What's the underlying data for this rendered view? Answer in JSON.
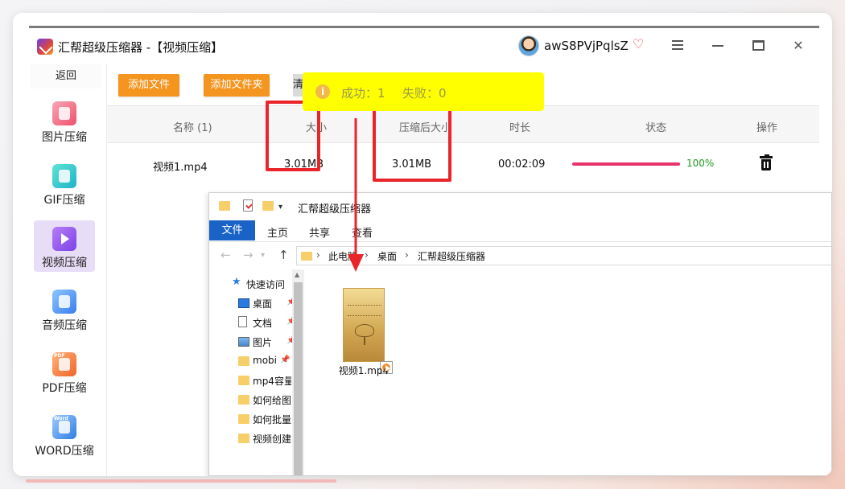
{
  "app": {
    "title": "汇帮超级压缩器  -【视频压缩】",
    "username": "awS8PVjPqlsZ"
  },
  "sidebar": {
    "back_label": "返回",
    "items": [
      {
        "label": "图片压缩",
        "icon": "image-icon"
      },
      {
        "label": "GIF压缩",
        "icon": "gif-icon"
      },
      {
        "label": "视频压缩",
        "icon": "video-icon",
        "active": true
      },
      {
        "label": "音频压缩",
        "icon": "audio-icon"
      },
      {
        "label": "PDF压缩",
        "icon": "pdf-icon",
        "tag": "PDF"
      },
      {
        "label": "WORD压缩",
        "icon": "word-icon",
        "tag": "Word"
      }
    ]
  },
  "toolbar": {
    "add_file": "添加文件",
    "add_folder": "添加文件夹",
    "partial_button": "清"
  },
  "toast": {
    "success_text": "成功：1",
    "fail_text": "失败：0"
  },
  "table": {
    "headers": {
      "name": "名称 (1)",
      "size": "大小",
      "compressed_size": "压缩后大小",
      "duration": "时长",
      "status": "状态",
      "action": "操作"
    },
    "rows": [
      {
        "name": "视频1.mp4",
        "size": "3.01MB",
        "compressed_size": "3.01MB",
        "duration": "00:02:09",
        "progress_percent": 100,
        "progress_text": "100%"
      }
    ]
  },
  "explorer": {
    "title": "汇帮超级压缩器",
    "ribbon_tabs": [
      "文件",
      "主页",
      "共享",
      "查看"
    ],
    "breadcrumbs": [
      "此电脑",
      "桌面",
      "汇帮超级压缩器"
    ],
    "nav_items": [
      {
        "label": "快速访问",
        "icon": "star-icon"
      },
      {
        "label": "桌面",
        "icon": "desktop-icon",
        "pinned": true
      },
      {
        "label": "文档",
        "icon": "document-icon",
        "pinned": true
      },
      {
        "label": "图片",
        "icon": "pictures-icon",
        "pinned": true
      },
      {
        "label": "mobi",
        "icon": "folder-icon",
        "pinned": true
      },
      {
        "label": "mp4容量",
        "icon": "folder-icon"
      },
      {
        "label": "如何给图",
        "icon": "folder-icon"
      },
      {
        "label": "如何批量",
        "icon": "folder-icon"
      },
      {
        "label": "视频创建",
        "icon": "folder-icon"
      }
    ],
    "files": [
      {
        "name": "视频1.mp4",
        "icon": "video-file-icon"
      }
    ]
  },
  "colors": {
    "accent_orange": "#f4951f",
    "highlight_red": "#e9252a",
    "toast_yellow": "#ffff00",
    "progress_pink": "#e8336b",
    "progress_text_green": "#1f9b1f",
    "active_sidebar": "#e8ddf6",
    "explorer_blue": "#1a63c6"
  }
}
